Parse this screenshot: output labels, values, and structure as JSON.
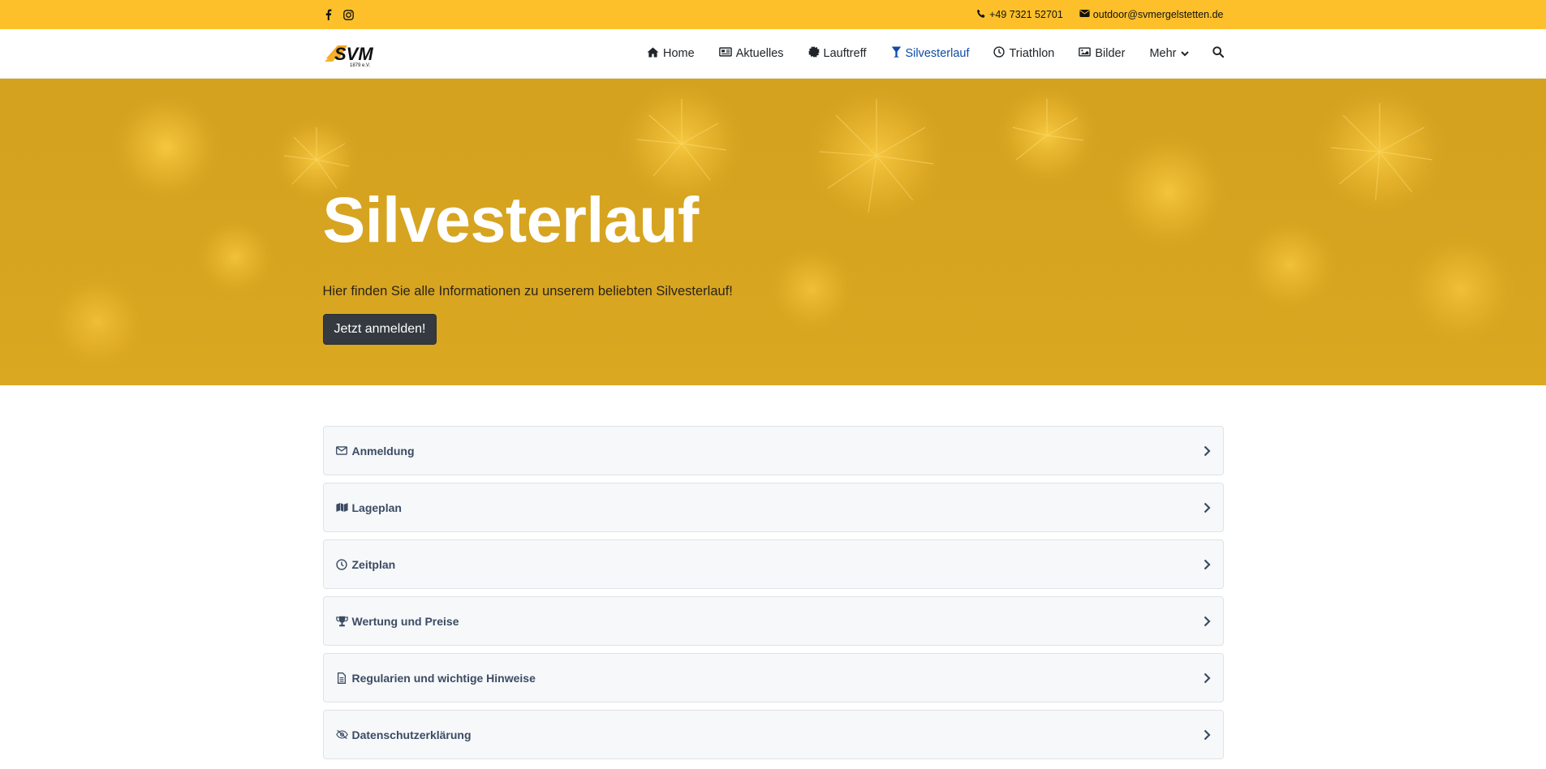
{
  "topbar": {
    "social": [
      "facebook-icon",
      "instagram-icon"
    ],
    "phone": "+49 7321 52701",
    "email": "outdoor@svmergelstetten.de",
    "bg_color": "#fdc02a"
  },
  "logo": {
    "text": "SVM",
    "sub": "1879 e.V."
  },
  "nav": {
    "items": [
      {
        "label": "Home",
        "icon": "home-icon"
      },
      {
        "label": "Aktuelles",
        "icon": "newspaper-icon"
      },
      {
        "label": "Lauftreff",
        "icon": "badge-icon"
      },
      {
        "label": "Silvesterlauf",
        "icon": "glass-icon",
        "active": true
      },
      {
        "label": "Triathlon",
        "icon": "clock-icon"
      },
      {
        "label": "Bilder",
        "icon": "image-icon"
      },
      {
        "label": "Mehr",
        "icon": "chevron-down-icon"
      }
    ],
    "active_color": "#0d4aa8"
  },
  "hero": {
    "title": "Silvesterlauf",
    "subtitle": "Hier finden Sie alle Informationen zu unserem beliebten Silvesterlauf!",
    "button": "Jetzt anmelden!"
  },
  "accordion": [
    {
      "label": "Anmeldung",
      "icon": "envelope-icon"
    },
    {
      "label": "Lageplan",
      "icon": "map-icon"
    },
    {
      "label": "Zeitplan",
      "icon": "clock-icon"
    },
    {
      "label": "Wertung und Preise",
      "icon": "trophy-icon"
    },
    {
      "label": "Regularien und wichtige Hinweise",
      "icon": "document-icon"
    },
    {
      "label": "Datenschutzerklärung",
      "icon": "eye-slash-icon"
    }
  ]
}
